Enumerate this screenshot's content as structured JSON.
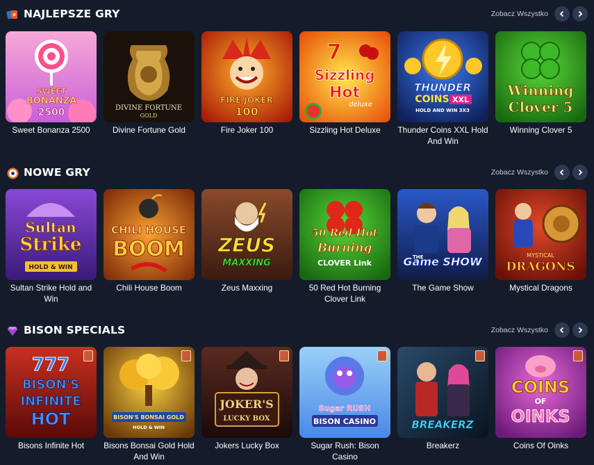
{
  "sections": [
    {
      "title": "NAJLEPSZE GRY",
      "icon": "trophy-cards-icon",
      "see_all": "Zobacz Wszystko",
      "games": [
        {
          "name": "Sweet Bonanza 2500",
          "art": [
            "SWEET",
            "BONANZA",
            "2500"
          ]
        },
        {
          "name": "Divine Fortune Gold",
          "art": [
            "DIVINE FORTUNE",
            "GOLD"
          ]
        },
        {
          "name": "Fire Joker 100",
          "art": [
            "FIRE JOKER",
            "100"
          ]
        },
        {
          "name": "Sizzling Hot Deluxe",
          "art": [
            "7",
            "Sizzling",
            "Hot",
            "deluxe"
          ]
        },
        {
          "name": "Thunder Coins XXL Hold And Win",
          "art": [
            "THUNDER",
            "COINS",
            "XXL",
            "HOLD AND WIN 3X3"
          ]
        },
        {
          "name": "Winning Clover 5",
          "art": [
            "Winning",
            "Clover 5"
          ]
        }
      ]
    },
    {
      "title": "NOWE GRY",
      "icon": "roulette-icon",
      "see_all": "Zobacz Wszystko",
      "games": [
        {
          "name": "Sultan Strike Hold and Win",
          "art": [
            "Sultan",
            "Strike",
            "HOLD & WIN"
          ]
        },
        {
          "name": "Chili House Boom",
          "art": [
            "CHILI HOUSE",
            "BOOM"
          ]
        },
        {
          "name": "Zeus Maxxing",
          "art": [
            "ZEUS",
            "MAXXING"
          ]
        },
        {
          "name": "50 Red Hot Burning Clover Link",
          "art": [
            "50 Red Hot",
            "Burning",
            "CLOVER Link"
          ]
        },
        {
          "name": "The Game Show",
          "art": [
            "THE",
            "Game SHOW"
          ]
        },
        {
          "name": "Mystical Dragons",
          "art": [
            "MYSTICAL",
            "DRAGONS"
          ]
        }
      ]
    },
    {
      "title": "BISON SPECIALS",
      "icon": "gem-icon",
      "see_all": "Zobacz Wszystko",
      "games": [
        {
          "name": "Bisons Infinite Hot",
          "art": [
            "777",
            "BISON'S",
            "INFINITE",
            "HOT"
          ]
        },
        {
          "name": "Bisons Bonsai Gold Hold And Win",
          "art": [
            "BISON'S BONSAI GOLD",
            "HOLD & WIN"
          ]
        },
        {
          "name": "Jokers Lucky Box",
          "art": [
            "JOKER'S",
            "LUCKY BOX"
          ]
        },
        {
          "name": "Sugar Rush: Bison Casino",
          "art": [
            "Sugar RUSH",
            "BISON CASINO"
          ]
        },
        {
          "name": "Breakerz",
          "art": [
            "BREAKERZ"
          ]
        },
        {
          "name": "Coins Of Oinks",
          "art": [
            "COINS",
            "OF",
            "OINKS"
          ]
        }
      ]
    }
  ],
  "colors": {
    "background": "#141c2b",
    "arrow_bg": "#2e3a52",
    "see_all_text": "#c5cad6"
  }
}
